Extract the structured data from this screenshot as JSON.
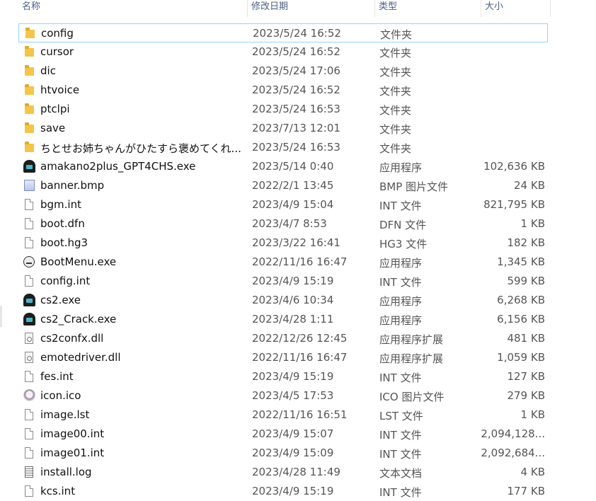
{
  "columns": {
    "name": "名称",
    "date": "修改日期",
    "type": "类型",
    "size": "大小"
  },
  "files": [
    {
      "name": "config",
      "date": "2023/5/24 16:52",
      "type": "文件夹",
      "size": "",
      "icon": "folder-icon"
    },
    {
      "name": "cursor",
      "date": "2023/5/24 16:52",
      "type": "文件夹",
      "size": "",
      "icon": "folder-icon"
    },
    {
      "name": "dic",
      "date": "2023/5/24 17:06",
      "type": "文件夹",
      "size": "",
      "icon": "folder-icon"
    },
    {
      "name": "htvoice",
      "date": "2023/5/24 16:52",
      "type": "文件夹",
      "size": "",
      "icon": "folder-icon"
    },
    {
      "name": "ptclpi",
      "date": "2023/5/24 16:53",
      "type": "文件夹",
      "size": "",
      "icon": "folder-icon"
    },
    {
      "name": "save",
      "date": "2023/7/13 12:01",
      "type": "文件夹",
      "size": "",
      "icon": "folder-icon"
    },
    {
      "name": "ちとせお姉ちゃんがひたすら褒めてくれ...",
      "date": "2023/5/24 16:53",
      "type": "文件夹",
      "size": "",
      "icon": "folder-icon"
    },
    {
      "name": "amakano2plus_GPT4CHS.exe",
      "date": "2023/5/14 0:40",
      "type": "应用程序",
      "size": "102,636 KB",
      "icon": "app-icon"
    },
    {
      "name": "banner.bmp",
      "date": "2022/2/1 13:45",
      "type": "BMP 图片文件",
      "size": "24 KB",
      "icon": "image-icon"
    },
    {
      "name": "bgm.int",
      "date": "2023/4/9 15:04",
      "type": "INT 文件",
      "size": "821,795 KB",
      "icon": "file-icon"
    },
    {
      "name": "boot.dfn",
      "date": "2023/4/7 8:53",
      "type": "DFN 文件",
      "size": "1 KB",
      "icon": "file-icon"
    },
    {
      "name": "boot.hg3",
      "date": "2023/3/22 16:41",
      "type": "HG3 文件",
      "size": "182 KB",
      "icon": "file-icon"
    },
    {
      "name": "BootMenu.exe",
      "date": "2022/11/16 16:47",
      "type": "应用程序",
      "size": "1,345 KB",
      "icon": "app-face-icon"
    },
    {
      "name": "config.int",
      "date": "2023/4/9 15:19",
      "type": "INT 文件",
      "size": "599 KB",
      "icon": "file-icon"
    },
    {
      "name": "cs2.exe",
      "date": "2023/4/6 10:34",
      "type": "应用程序",
      "size": "6,268 KB",
      "icon": "app-icon"
    },
    {
      "name": "cs2_Crack.exe",
      "date": "2023/4/28 1:11",
      "type": "应用程序",
      "size": "6,156 KB",
      "icon": "app-icon"
    },
    {
      "name": "cs2confx.dll",
      "date": "2022/12/26 12:45",
      "type": "应用程序扩展",
      "size": "481 KB",
      "icon": "dll-icon"
    },
    {
      "name": "emotedriver.dll",
      "date": "2022/11/16 16:47",
      "type": "应用程序扩展",
      "size": "1,059 KB",
      "icon": "dll-icon"
    },
    {
      "name": "fes.int",
      "date": "2023/4/9 15:19",
      "type": "INT 文件",
      "size": "127 KB",
      "icon": "file-icon"
    },
    {
      "name": "icon.ico",
      "date": "2023/4/5 17:53",
      "type": "ICO 图片文件",
      "size": "279 KB",
      "icon": "ico-icon"
    },
    {
      "name": "image.lst",
      "date": "2022/11/16 16:51",
      "type": "LST 文件",
      "size": "1 KB",
      "icon": "file-icon"
    },
    {
      "name": "image00.int",
      "date": "2023/4/9 15:07",
      "type": "INT 文件",
      "size": "2,094,128...",
      "icon": "file-icon"
    },
    {
      "name": "image01.int",
      "date": "2023/4/9 15:09",
      "type": "INT 文件",
      "size": "2,092,684...",
      "icon": "file-icon"
    },
    {
      "name": "install.log",
      "date": "2023/4/28 11:49",
      "type": "文本文档",
      "size": "4 KB",
      "icon": "text-file-icon"
    },
    {
      "name": "kcs.int",
      "date": "2023/4/9 15:19",
      "type": "INT 文件",
      "size": "177 KB",
      "icon": "file-icon"
    }
  ],
  "selected_index": 0
}
